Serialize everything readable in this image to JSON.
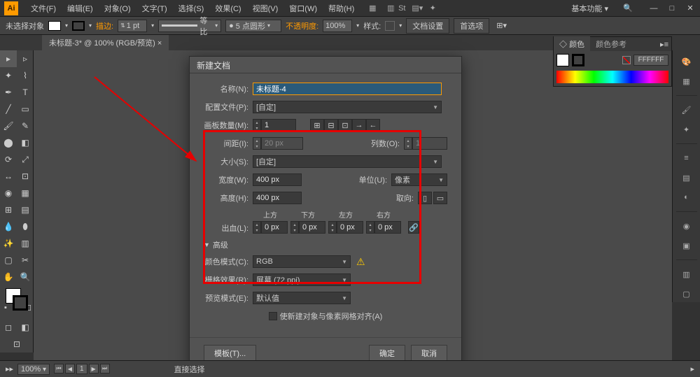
{
  "menubar": {
    "logo": "Ai",
    "items": [
      "文件(F)",
      "编辑(E)",
      "对象(O)",
      "文字(T)",
      "选择(S)",
      "效果(C)",
      "视图(V)",
      "窗口(W)",
      "帮助(H)"
    ],
    "workspace": "基本功能"
  },
  "optionsbar": {
    "noselection": "未选择对象",
    "stroke_label": "描边:",
    "stroke_value": "1 pt",
    "uniform": "等比",
    "brush": "5 点圆形",
    "opacity_label": "不透明度:",
    "opacity_value": "100%",
    "style_label": "样式:",
    "doc_setup": "文档设置",
    "prefs": "首选项"
  },
  "tabbar": {
    "doc": "未标题-3* @ 100% (RGB/预览)"
  },
  "color_panel": {
    "tab1": "颜色",
    "tab2": "颜色参考",
    "hex": "FFFFFF"
  },
  "dialog": {
    "title": "新建文档",
    "name_label": "名称(N):",
    "name_value": "未标题-4",
    "profile_label": "配置文件(P):",
    "profile_value": "[自定]",
    "artboards_label": "画板数量(M):",
    "artboards_value": "1",
    "spacing_label": "间距(I):",
    "spacing_value": "20 px",
    "columns_label": "列数(O):",
    "columns_value": "1",
    "size_label": "大小(S):",
    "size_value": "[自定]",
    "width_label": "宽度(W):",
    "width_value": "400 px",
    "units_label": "单位(U):",
    "units_value": "像素",
    "height_label": "高度(H):",
    "height_value": "400 px",
    "orient_label": "取向:",
    "bleed_label": "出血(L):",
    "bleed_top": "上方",
    "bleed_bottom": "下方",
    "bleed_left": "左方",
    "bleed_right": "右方",
    "bleed_value": "0 px",
    "advanced": "高级",
    "colormode_label": "颜色模式(C):",
    "colormode_value": "RGB",
    "raster_label": "栅格效果(R):",
    "raster_value": "屏幕 (72 ppi)",
    "preview_label": "预览模式(E):",
    "preview_value": "默认值",
    "align_pixel": "使新建对象与像素网格对齐(A)",
    "templates_btn": "模板(T)...",
    "ok_btn": "确定",
    "cancel_btn": "取消"
  },
  "statusbar": {
    "zoom": "100%",
    "artboard": "1",
    "tool": "直接选择"
  }
}
